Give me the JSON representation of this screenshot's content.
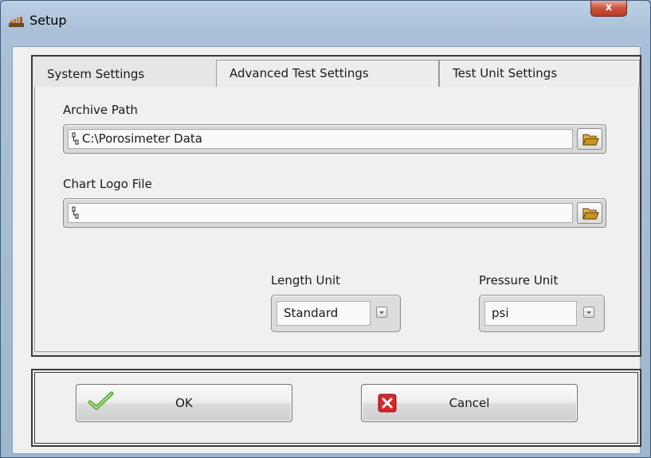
{
  "window": {
    "title": "Setup",
    "close_glyph": "x"
  },
  "tabs": [
    {
      "label": "System Settings",
      "active": true
    },
    {
      "label": "Advanced Test Settings",
      "active": false
    },
    {
      "label": "Test Unit Settings",
      "active": false
    }
  ],
  "system_settings": {
    "archive_path": {
      "label": "Archive Path",
      "value": "C:\\Porosimeter Data"
    },
    "chart_logo_file": {
      "label": "Chart Logo File",
      "value": ""
    },
    "length_unit": {
      "label": "Length Unit",
      "value": "Standard"
    },
    "pressure_unit": {
      "label": "Pressure Unit",
      "value": "psi"
    }
  },
  "buttons": {
    "ok": {
      "label": "OK",
      "icon": "checkmark-icon",
      "icon_color": "#5cae3a"
    },
    "cancel": {
      "label": "Cancel",
      "icon": "red-x-icon",
      "icon_color": "#d8262b"
    }
  },
  "icons": {
    "browse": "folder-open-icon",
    "folder_color": "#c8961e",
    "app": "chart-app-icon"
  }
}
